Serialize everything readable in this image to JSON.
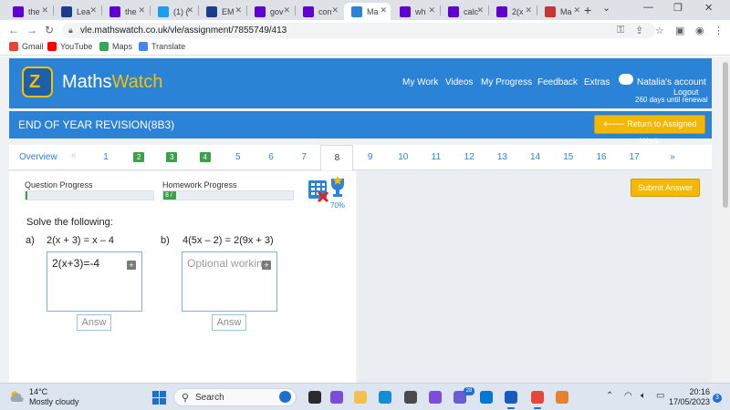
{
  "browser": {
    "tabs": [
      {
        "label": "the",
        "favicon": "yahoo-icon",
        "color": "#6001d2"
      },
      {
        "label": "Lea",
        "favicon": "shield-icon",
        "color": "#1a3e8c"
      },
      {
        "label": "the",
        "favicon": "yahoo-icon",
        "color": "#6001d2"
      },
      {
        "label": "(1) (",
        "favicon": "twitter-icon",
        "color": "#1d9bf0"
      },
      {
        "label": "EM",
        "favicon": "shield-icon",
        "color": "#1a3e8c"
      },
      {
        "label": "gov",
        "favicon": "yahoo-icon",
        "color": "#6001d2"
      },
      {
        "label": "con",
        "favicon": "yahoo-icon",
        "color": "#6001d2"
      },
      {
        "label": "Ma",
        "favicon": "mathswatch-icon",
        "color": "#2b83d8"
      },
      {
        "label": "wh",
        "favicon": "yahoo-icon",
        "color": "#6001d2"
      },
      {
        "label": "calc",
        "favicon": "yahoo-icon",
        "color": "#6001d2"
      },
      {
        "label": "2(x",
        "favicon": "yahoo-icon",
        "color": "#6001d2"
      },
      {
        "label": "Ma",
        "favicon": "m-icon",
        "color": "#c7372f"
      }
    ],
    "url": "vle.mathswatch.co.uk/vle/assignment/7855749/413",
    "bookmarks": [
      "Gmail",
      "YouTube",
      "Maps",
      "Translate"
    ]
  },
  "header": {
    "logo_part1": "Maths",
    "logo_part2": "Watch",
    "nav": [
      "My Work",
      "Videos",
      "My Progress",
      "Feedback",
      "Extras"
    ],
    "account_name": "Natalia's account",
    "logout": "Logout",
    "renewal": "260 days until renewal"
  },
  "assignment": {
    "title": "END OF YEAR REVISION(8B3)",
    "return_button": "Return to Assigned Work",
    "overview": "Overview",
    "prev": "«",
    "next": "»",
    "questions": [
      "1",
      "2",
      "3",
      "4",
      "5",
      "6",
      "7",
      "8",
      "9",
      "10",
      "11",
      "12",
      "13",
      "14",
      "15",
      "16",
      "17"
    ],
    "completed": [
      "2",
      "3",
      "4"
    ],
    "current": "8"
  },
  "progress": {
    "question_label": "Question Progress",
    "question_fraction": 0,
    "homework_label": "Homework Progress",
    "homework_text": "8 /",
    "homework_fraction": 0.1,
    "score_percent": "70%"
  },
  "question": {
    "instruction": "Solve the following:",
    "parts": [
      {
        "letter": "a)",
        "equation": "2(x + 3) = x – 4",
        "working": "2(x+3)=-4",
        "placeholder": "Optional working",
        "answer_placeholder": "Answ"
      },
      {
        "letter": "b)",
        "equation": "4(5x – 2) = 2(9x + 3)",
        "working": "",
        "placeholder": "Optional working",
        "answer_placeholder": "Answ"
      }
    ],
    "submit": "Submit Answer"
  },
  "taskbar": {
    "temperature": "14°C",
    "weather": "Mostly cloudy",
    "search": "Search",
    "badge": "28",
    "time": "20:16",
    "date": "17/05/2023",
    "notifications": "3"
  },
  "colors": {
    "brand_blue": "#2b83d8",
    "accent_yellow": "#f5b800",
    "done_green": "#3aa14a"
  }
}
